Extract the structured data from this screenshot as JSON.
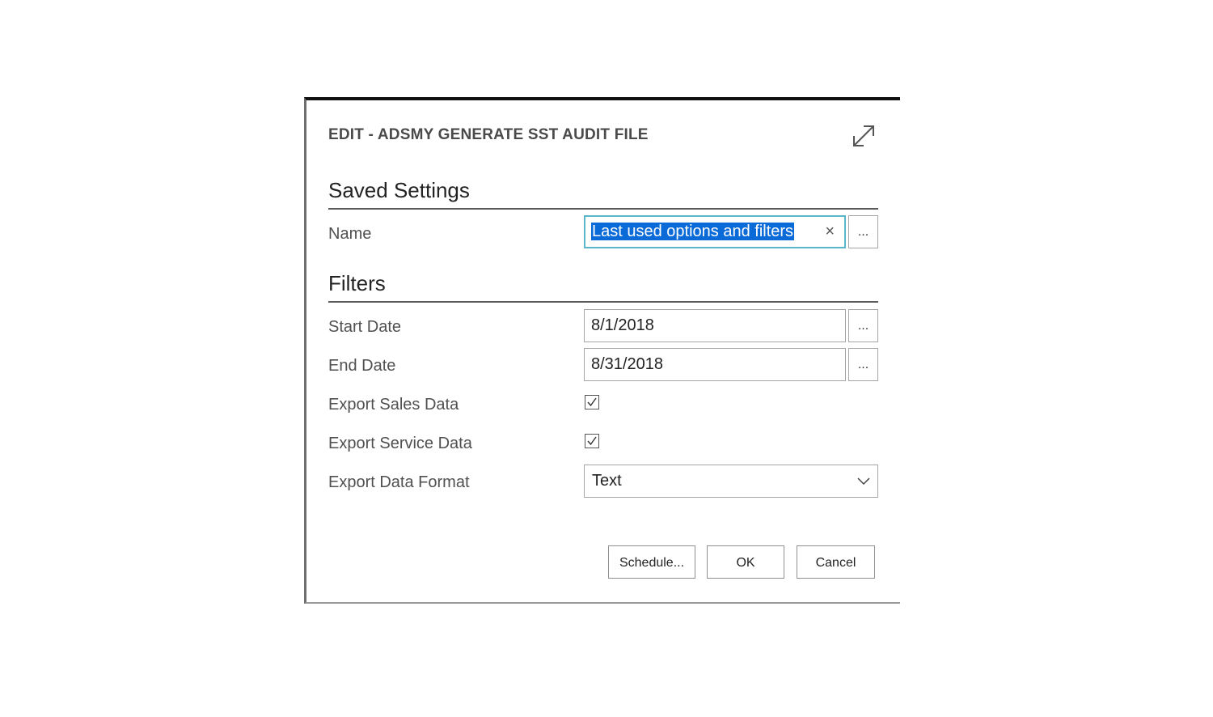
{
  "dialog": {
    "title": "EDIT - ADSMY GENERATE SST AUDIT FILE",
    "expand_icon": "expand-diagonal-arrows-icon"
  },
  "saved_settings": {
    "heading": "Saved Settings",
    "name_label": "Name",
    "name_value": "Last used options and filters",
    "clear_glyph": "×",
    "lookup_label": "..."
  },
  "filters": {
    "heading": "Filters",
    "start_date_label": "Start Date",
    "start_date_value": "8/1/2018",
    "end_date_label": "End Date",
    "end_date_value": "8/31/2018",
    "lookup_label": "...",
    "export_sales_label": "Export Sales Data",
    "export_sales_checked": true,
    "export_service_label": "Export Service Data",
    "export_service_checked": true,
    "export_format_label": "Export Data Format",
    "export_format_value": "Text"
  },
  "buttons": {
    "schedule": "Schedule...",
    "ok": "OK",
    "cancel": "Cancel"
  },
  "colors": {
    "selection_highlight": "#0a6ad7",
    "focus_border": "#59b7c9"
  }
}
